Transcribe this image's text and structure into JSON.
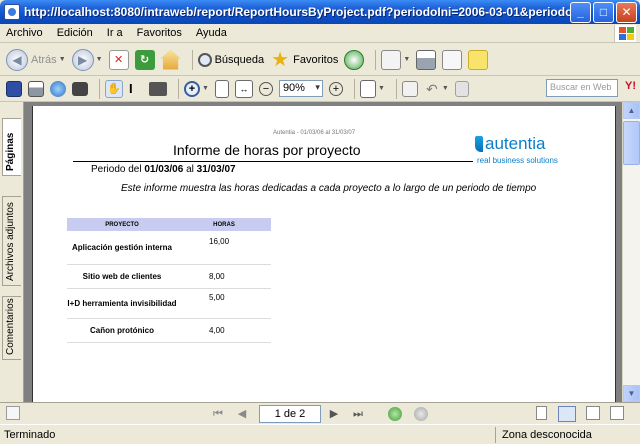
{
  "window": {
    "title": "http://localhost:8080/intraweb/report/ReportHoursByProject.pdf?periodoIni=2006-03-01&periodoFin - Mi..."
  },
  "menu": [
    "Archivo",
    "Edición",
    "Ir a",
    "Favoritos",
    "Ayuda"
  ],
  "toolbar": {
    "back_label": "Atrás",
    "search_label": "Búsqueda",
    "favorites_label": "Favoritos",
    "zoom_value": "90%",
    "search_web_placeholder": "Buscar en Web"
  },
  "side_tabs": [
    "Páginas",
    "Archivos adjuntos",
    "Comentarios"
  ],
  "report": {
    "tagline": "Autentia - 01/03/06 al 31/03/07",
    "title": "Informe de horas por proyecto",
    "logo_brand": "autentia",
    "logo_sub": "real business solutions",
    "period_label": "Periodo del",
    "period_start": "01/03/06",
    "period_sep": "al",
    "period_end": "31/03/07",
    "description": "Este informe muestra las horas dedicadas a cada proyecto a lo largo de un periodo de tiempo",
    "columns": [
      "PROYECTO",
      "HORAS"
    ],
    "rows": [
      {
        "project": "Aplicación gestión interna",
        "hours": "16,00"
      },
      {
        "project": "Sitio web de clientes",
        "hours": "8,00"
      },
      {
        "project": "I+D herramienta invisibilidad",
        "hours": "5,00"
      },
      {
        "project": "Cañon protónico",
        "hours": "4,00"
      }
    ]
  },
  "pager": {
    "page_indicator": "1 de 2"
  },
  "status": {
    "left": "Terminado",
    "zone": "Zona desconocida"
  },
  "colors": {
    "title_bar": "#0A4FC9",
    "chrome": "#ECE9D8",
    "doc_background": "#808080",
    "table_header": "#c8ccf0",
    "brand": "#0b7ec9"
  }
}
